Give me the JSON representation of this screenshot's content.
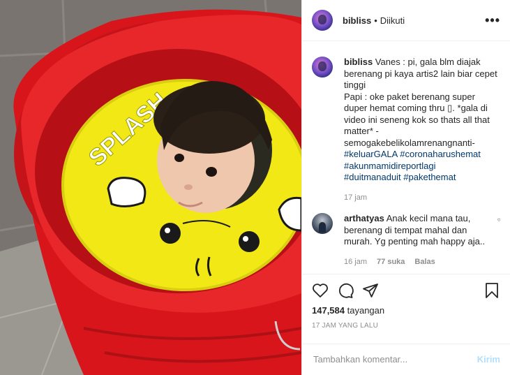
{
  "header": {
    "username": "bibliss",
    "separator": "•",
    "follow_status": "Diikuti",
    "more_icon": "more-horizontal-icon"
  },
  "caption": {
    "username": "bibliss",
    "text": " Vanes : pi, gala blm diajak berenang pi kaya artis2 lain biar cepet tinggi\nPapi : oke paket berenang super duper hemat coming thru ▯. *gala di video ini seneng kok so thats all that matter* - semogakebelikolamrenangnanti-\n",
    "hashtags": [
      "#keluarGALA",
      "#coronaharushemat",
      "#akunmamidireportlagi",
      "#duitmanaduit",
      "#pakethemat"
    ],
    "time": "17 jam"
  },
  "comment": {
    "username": "arthatyas",
    "text": " Anak kecil mana tau, berenang di tempat mahal dan murah. Yg penting mah happy aja..",
    "time": "16 jam",
    "likes": "77 suka",
    "reply": "Balas"
  },
  "actions": {
    "views_count": "147,584",
    "views_label": "tayangan",
    "time_ago": "17 JAM YANG LALU"
  },
  "add_comment": {
    "placeholder": "Tambahkan komentar...",
    "send_label": "Kirim"
  },
  "colors": {
    "bucket_red": "#e11b1b",
    "float_yellow": "#f2e816",
    "hashtag": "#00376b",
    "send_disabled": "#b2dffc"
  }
}
